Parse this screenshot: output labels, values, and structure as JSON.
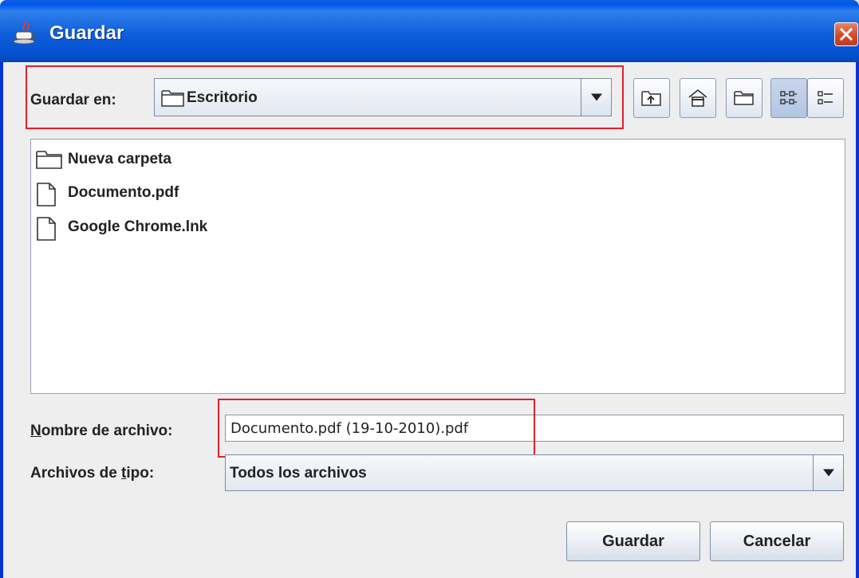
{
  "window": {
    "title": "Guardar",
    "title_icon": "java-cup-icon",
    "close_icon": "close-icon"
  },
  "save_in": {
    "label": "Guardar en:",
    "value": "Escritorio",
    "value_icon": "folder-icon"
  },
  "toolbar": {
    "up_folder_icon": "up-one-level-icon",
    "home_icon": "home-icon",
    "new_folder_icon": "new-folder-icon",
    "list_view_icon": "list-view-icon",
    "details_view_icon": "details-view-icon",
    "active_view": "list"
  },
  "files": [
    {
      "name": "Nueva carpeta",
      "icon": "folder-icon"
    },
    {
      "name": "Documento.pdf",
      "icon": "file-icon"
    },
    {
      "name": "Google Chrome.lnk",
      "icon": "file-icon"
    }
  ],
  "filename": {
    "label_mnemonic": "N",
    "label_rest": "ombre de archivo:",
    "value": "Documento.pdf (19-10-2010).pdf"
  },
  "filetype": {
    "label_pre": "Archivos de ",
    "label_mnemonic": "t",
    "label_post": "ipo:",
    "value": "Todos los archivos"
  },
  "buttons": {
    "save": "Guardar",
    "cancel": "Cancelar"
  },
  "colors": {
    "titlebar": "#0058ee",
    "highlight": "#e0202a",
    "close_button": "#d44a2a"
  }
}
